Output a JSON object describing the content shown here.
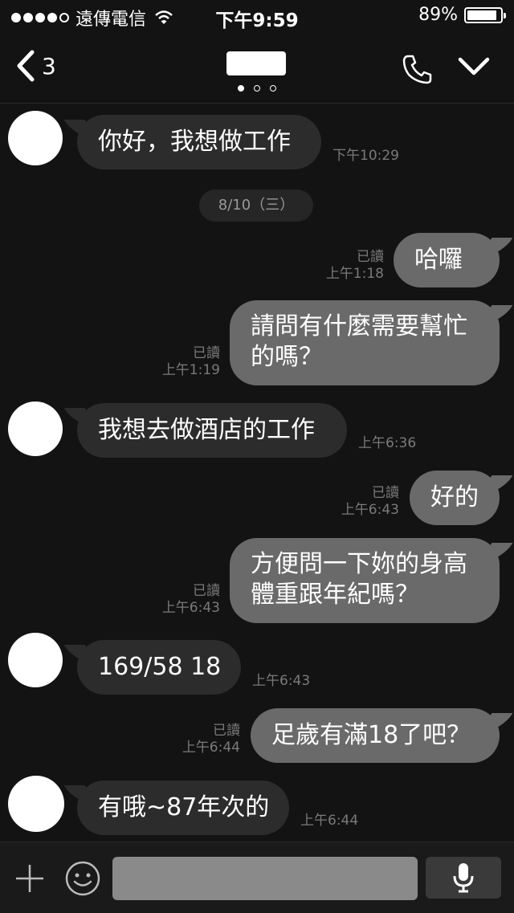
{
  "status_bar": {
    "carrier": "遠傳電信",
    "time": "下午9:59",
    "battery": "89%",
    "battery_level": 0.89,
    "signal_bars_filled": 4
  },
  "nav": {
    "back_count": "3",
    "back_icon": "chevron-left-icon",
    "call_icon": "phone-icon",
    "menu_icon": "chevron-down-icon"
  },
  "messages": [
    {
      "dir": "in",
      "text": "你好，我想做工作",
      "time": "下午10:29"
    },
    {
      "dir": "date",
      "text": "8/10（三）"
    },
    {
      "dir": "out",
      "text": "哈囉",
      "read": "已讀",
      "time": "上午1:18"
    },
    {
      "dir": "out",
      "text_line1": "請問有什麼需要幫忙",
      "text_line2": "的嗎？",
      "read": "已讀",
      "time": "上午1:19"
    },
    {
      "dir": "in",
      "text": "我想去做酒店的工作",
      "time": "上午6:36"
    },
    {
      "dir": "out",
      "text": "好的",
      "read": "已讀",
      "time": "上午6:43"
    },
    {
      "dir": "out",
      "text_line1": "方便問一下妳的身高",
      "text_line2": "體重跟年紀嗎？",
      "read": "已讀",
      "time": "上午6:43"
    },
    {
      "dir": "in",
      "text": "169/58  18",
      "time": "上午6:43"
    },
    {
      "dir": "out",
      "text": "足歲有滿18了吧？",
      "read": "已讀",
      "time": "上午6:44"
    },
    {
      "dir": "in",
      "text": "有哦~87年次的",
      "time": "上午6:44"
    }
  ],
  "input_bar": {
    "plus_icon": "plus-icon",
    "emoji_icon": "emoji-icon",
    "mic_icon": "microphone-icon"
  },
  "colors": {
    "background": "#131313",
    "incoming_bubble": "#2c2c2c",
    "outgoing_bubble": "#6a6a6a",
    "meta_text": "#7a7a7a"
  }
}
